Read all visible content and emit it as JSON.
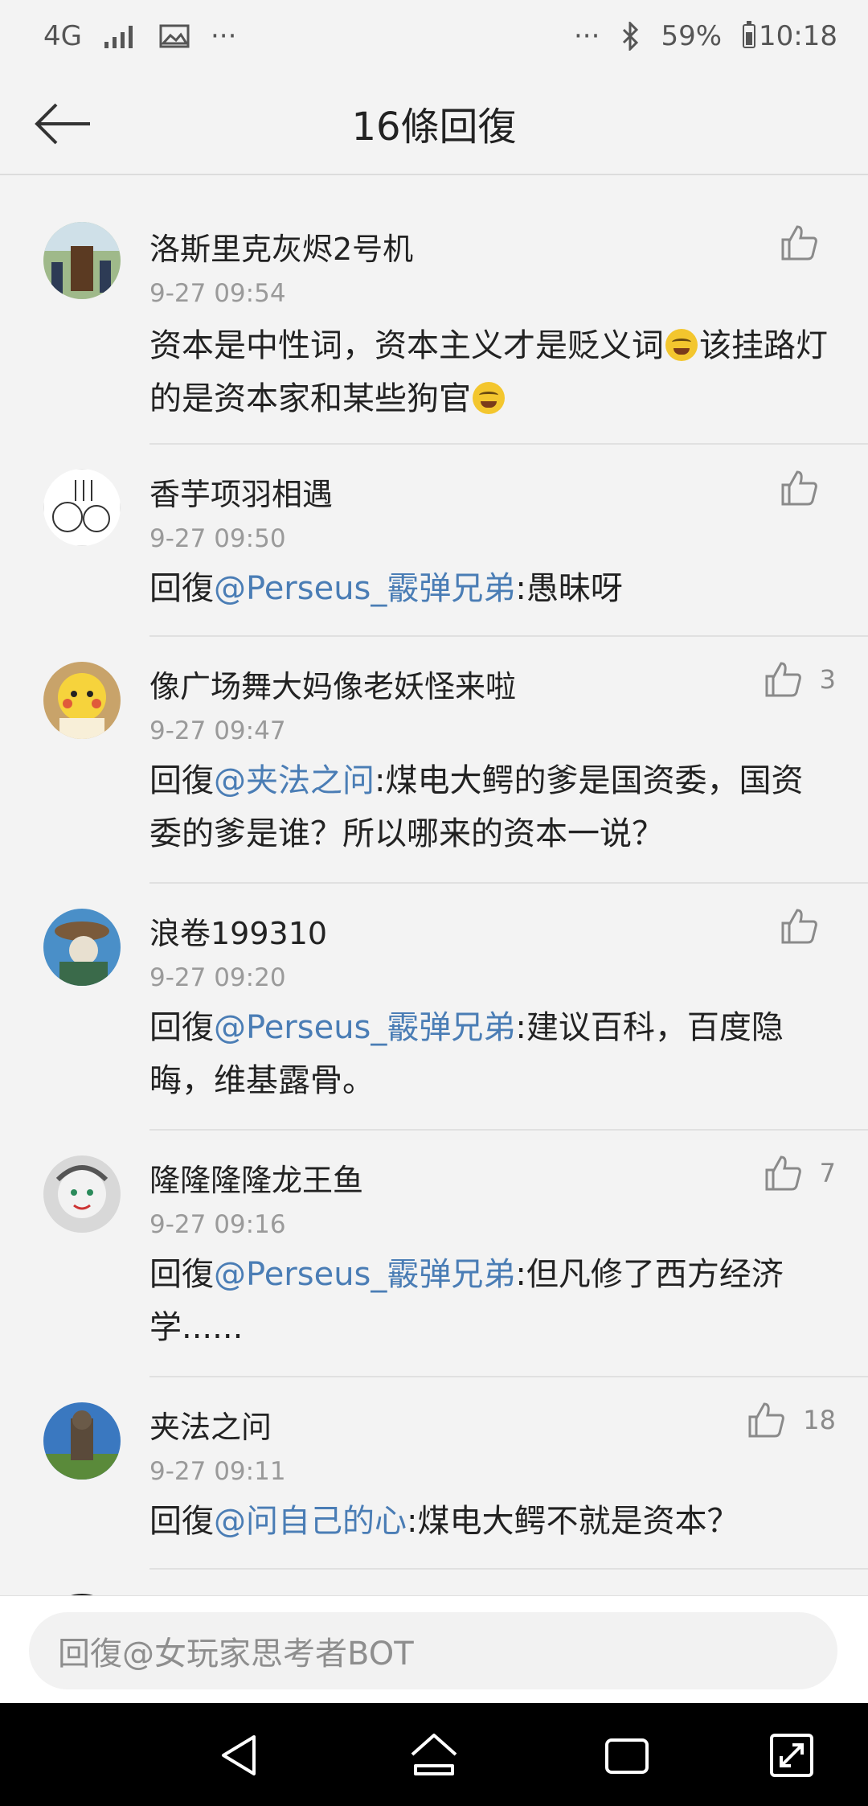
{
  "status_bar": {
    "network": "4G",
    "dots_left": "···",
    "dots_right": "···",
    "battery": "59%",
    "time": "10:18"
  },
  "header": {
    "title": "16條回復"
  },
  "comments": [
    {
      "user": "洛斯里克灰烬2号机",
      "time": "9-27 09:54",
      "text_a": "资本是中性词，资本主义才是贬义词",
      "text_b": "该挂路灯的是资本家和某些狗官",
      "likes": ""
    },
    {
      "user": "香芋项羽相遇",
      "time": "9-27 09:50",
      "reply_prefix": "回復",
      "mention": "@Perseus_霰弹兄弟",
      "text": ":愚昧呀",
      "likes": ""
    },
    {
      "user": "像广场舞大妈像老妖怪来啦",
      "time": "9-27 09:47",
      "reply_prefix": "回復",
      "mention": "@夹法之问",
      "text": ":煤电大鳄的爹是国资委，国资委的爹是谁？所以哪来的资本一说？",
      "likes": "3"
    },
    {
      "user": "浪卷199310",
      "time": "9-27 09:20",
      "reply_prefix": "回復",
      "mention": "@Perseus_霰弹兄弟",
      "text": ":建议百科，百度隐晦，维基露骨。",
      "likes": ""
    },
    {
      "user": "隆隆隆隆龙王鱼",
      "time": "9-27 09:16",
      "reply_prefix": "回復",
      "mention": "@Perseus_霰弹兄弟",
      "text": ":但凡修了西方经济学......",
      "likes": "7"
    },
    {
      "user": "夹法之问",
      "time": "9-27 09:11",
      "reply_prefix": "回復",
      "mention": "@问自己的心",
      "text": ":煤电大鳄不就是资本？",
      "likes": "18"
    }
  ],
  "reply_bar": {
    "placeholder": "回復@女玩家思考者BOT"
  },
  "icons": {
    "back": "back-arrow-icon",
    "like": "thumbs-up-icon",
    "emoji": "laughing-crying-emoji-icon",
    "nav_back": "nav-back-icon",
    "nav_home": "nav-home-icon",
    "nav_recents": "nav-recents-icon",
    "nav_expand": "nav-expand-icon"
  },
  "colors": {
    "mention": "#4a7db5",
    "background": "#f3f3f3",
    "nav_bar": "#000000"
  }
}
